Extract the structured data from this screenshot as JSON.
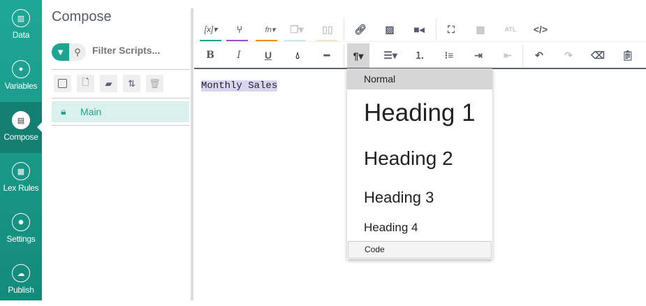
{
  "sidebar": {
    "items": [
      {
        "label": "Data",
        "icon": "bar-chart-icon"
      },
      {
        "label": "Variables",
        "icon": "map-pin-icon"
      },
      {
        "label": "Compose",
        "icon": "document-icon",
        "active": true
      },
      {
        "label": "Lex Rules",
        "icon": "rules-file-icon"
      },
      {
        "label": "Settings",
        "icon": "gear-icon"
      },
      {
        "label": "Publish",
        "icon": "cloud-upload-icon"
      }
    ]
  },
  "panel": {
    "title": "Compose",
    "filter_placeholder": "Filter Scripts...",
    "scripts": [
      {
        "name": "Main",
        "locked": true
      }
    ]
  },
  "editor": {
    "content": "Monthly Sales"
  },
  "format_menu": {
    "options": [
      "Normal",
      "Heading 1",
      "Heading 2",
      "Heading 3",
      "Heading 4",
      "Code"
    ],
    "selected": "Normal"
  },
  "colors": {
    "accent": "#1ea592",
    "variables": "#1ea592",
    "branch": "#9c4dcc",
    "functions": "#f0900f",
    "snippets": "#c8ecee",
    "library": "#f8e6c8"
  }
}
